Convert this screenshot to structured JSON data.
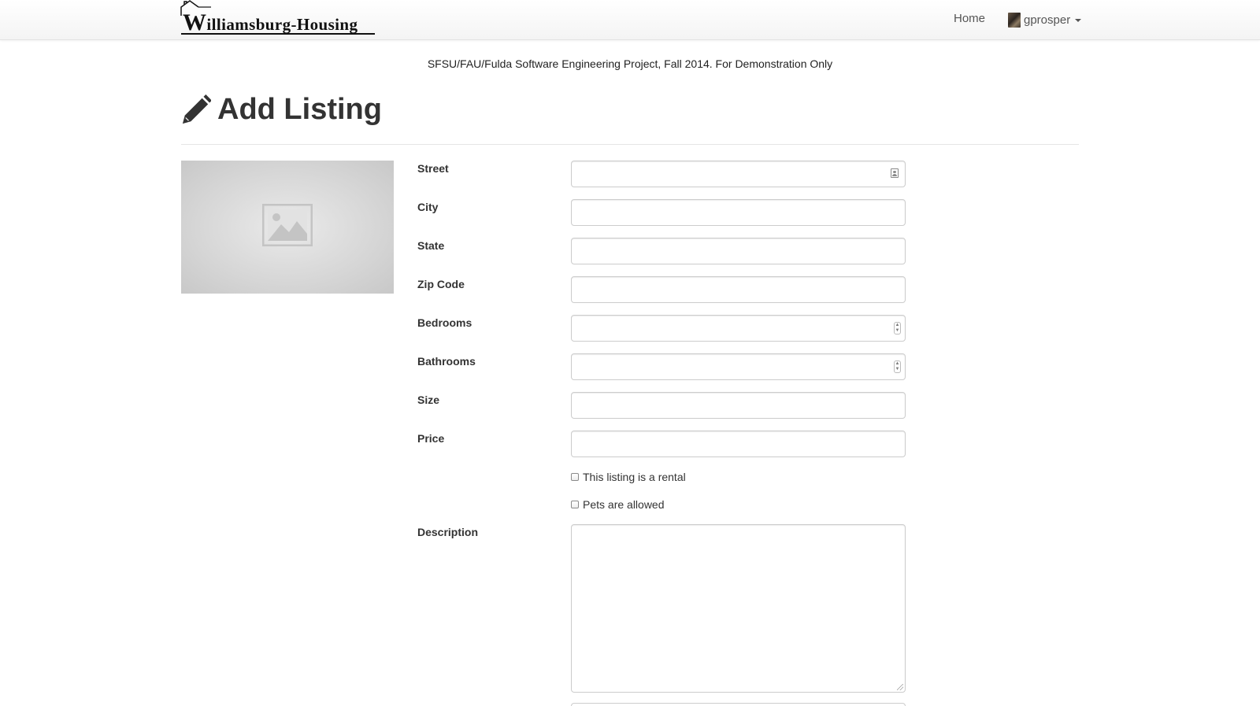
{
  "navbar": {
    "brand_text": "illiamsburg-Housing",
    "brand_initial": "W",
    "home_link": "Home",
    "username": "gprosper"
  },
  "notice": "SFSU/FAU/Fulda Software Engineering Project, Fall 2014. For Demonstration Only",
  "page": {
    "title": "Add Listing",
    "title_icon": "pencil-icon"
  },
  "photo": {
    "placeholder_icon": "image-placeholder-icon"
  },
  "form": {
    "street_label": "Street",
    "street_value": "",
    "city_label": "City",
    "city_value": "",
    "state_label": "State",
    "state_value": "",
    "zip_label": "Zip Code",
    "zip_value": "",
    "bedrooms_label": "Bedrooms",
    "bedrooms_value": "",
    "bathrooms_label": "Bathrooms",
    "bathrooms_value": "",
    "size_label": "Size",
    "size_value": "",
    "price_label": "Price",
    "price_value": "",
    "rental_label": "This listing is a rental",
    "rental_checked": false,
    "pets_label": "Pets are allowed",
    "pets_checked": false,
    "description_label": "Description",
    "description_value": ""
  },
  "colors": {
    "text": "#333333",
    "nav_text": "#555555",
    "border": "#cccccc"
  }
}
